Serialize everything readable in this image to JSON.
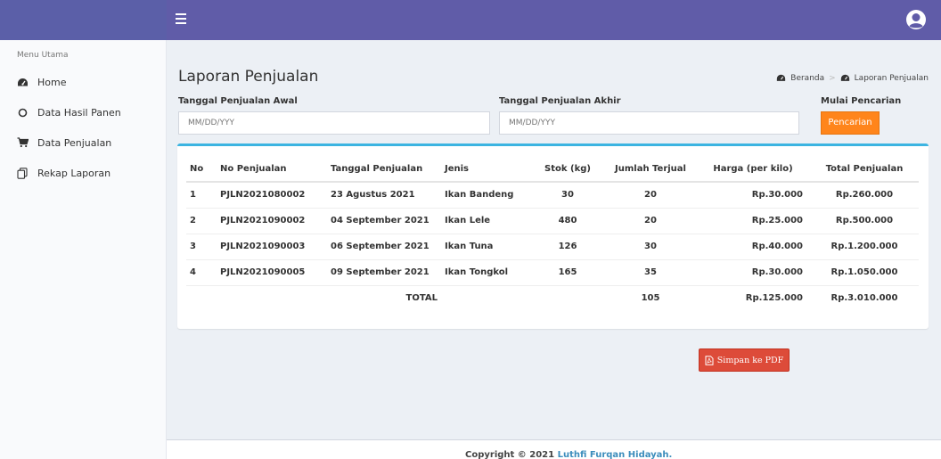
{
  "navbar": {
    "colors": {
      "bar": "#605ca8"
    }
  },
  "sidebar": {
    "header": "Menu Utama",
    "items": [
      {
        "label": "Home",
        "icon": "dashboard-icon"
      },
      {
        "label": "Data Hasil Panen",
        "icon": "circle-icon"
      },
      {
        "label": "Data Penjualan",
        "icon": "cart-icon"
      },
      {
        "label": "Rekap Laporan",
        "icon": "report-icon"
      }
    ]
  },
  "page": {
    "title": "Laporan Penjualan",
    "breadcrumb": [
      "Beranda",
      "Laporan Penjualan"
    ]
  },
  "filters": {
    "start_label": "Tanggal Penjualan Awal",
    "start_placeholder": "MM/DD/YYY",
    "end_label": "Tanggal Penjualan Akhir",
    "end_placeholder": "MM/DD/YYY",
    "search_label": "Mulai Pencarian",
    "search_button": "Pencarian"
  },
  "table": {
    "headers": [
      "No",
      "No Penjualan",
      "Tanggal Penjualan",
      "Jenis",
      "Stok (kg)",
      "Jumlah Terjual",
      "Harga (per kilo)",
      "Total Penjualan"
    ],
    "rows": [
      [
        "1",
        "PJLN2021080002",
        "23 Agustus 2021",
        "Ikan Bandeng",
        "30",
        "20",
        "Rp.30.000",
        "Rp.260.000"
      ],
      [
        "2",
        "PJLN2021090002",
        "04 September 2021",
        "Ikan Lele",
        "480",
        "20",
        "Rp.25.000",
        "Rp.500.000"
      ],
      [
        "3",
        "PJLN2021090003",
        "06 September 2021",
        "Ikan Tuna",
        "126",
        "30",
        "Rp.40.000",
        "Rp.1.200.000"
      ],
      [
        "4",
        "PJLN2021090005",
        "09 September 2021",
        "Ikan Tongkol",
        "165",
        "35",
        "Rp.30.000",
        "Rp.1.050.000"
      ]
    ],
    "total": {
      "label": "TOTAL",
      "jumlah": "105",
      "harga": "Rp.125.000",
      "total": "Rp.3.010.000"
    }
  },
  "actions": {
    "pdf_button": "Simpan ke PDF"
  },
  "footer": {
    "prefix": "Copyright © 2021 ",
    "author": "Luthfi Furqan Hidayah."
  }
}
